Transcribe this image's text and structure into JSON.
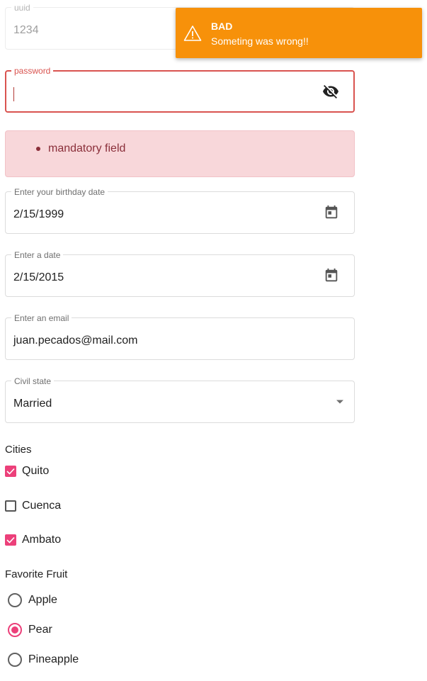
{
  "uuid_field": {
    "label": "uuid",
    "value": "1234"
  },
  "password_field": {
    "label": "password",
    "value": "",
    "toggle_icon": "eye-off-icon"
  },
  "error_alert": {
    "items": [
      "mandatory field"
    ]
  },
  "birthday_field": {
    "label": "Enter your birthday date",
    "value": "2/15/1999",
    "icon": "calendar-icon"
  },
  "date_field": {
    "label": "Enter a date",
    "value": "2/15/2015",
    "icon": "calendar-icon"
  },
  "email_field": {
    "label": "Enter an email",
    "value": "juan.pecados@mail.com"
  },
  "civil_state_field": {
    "label": "Civil state",
    "value": "Married",
    "icon": "dropdown-arrow-icon"
  },
  "cities": {
    "title": "Cities",
    "options": [
      {
        "label": "Quito",
        "checked": true
      },
      {
        "label": "Cuenca",
        "checked": false
      },
      {
        "label": "Ambato",
        "checked": true
      }
    ]
  },
  "favorite_fruit": {
    "title": "Favorite Fruit",
    "options": [
      {
        "label": "Apple",
        "selected": false
      },
      {
        "label": "Pear",
        "selected": true
      },
      {
        "label": "Pineapple",
        "selected": false
      }
    ]
  },
  "toast": {
    "title": "BAD",
    "message": "Someting was wrong!!",
    "icon": "warning-icon",
    "color": "#f7910a"
  },
  "colors": {
    "accent": "#ec407a",
    "error": "#d9534f",
    "alert_background": "#f8d7da",
    "alert_text": "#8a2f3a"
  }
}
